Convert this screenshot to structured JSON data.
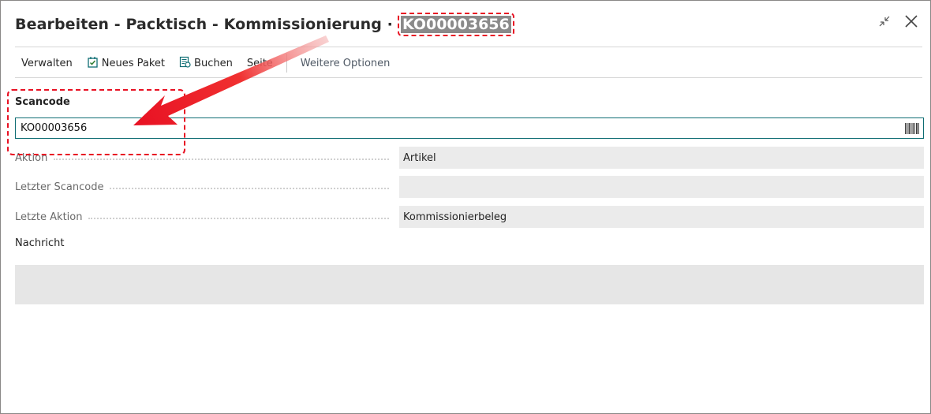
{
  "window": {
    "title": "Bearbeiten - Packtisch - Kommissionierung",
    "title_id": "KO00003656",
    "icons": {
      "collapse": "collapse-icon",
      "close": "close-icon"
    }
  },
  "toolbar": {
    "manage_label": "Verwalten",
    "new_package_label": "Neues Paket",
    "post_label": "Buchen",
    "page_label": "Seite",
    "more_options_label": "Weitere Optionen",
    "icons": {
      "new_package": "new-package-icon",
      "post": "post-icon"
    }
  },
  "form": {
    "scancode_label": "Scancode",
    "scancode_value": "KO00003656",
    "scancode_icon": "barcode-icon",
    "fields": [
      {
        "label": "Aktion",
        "value": "Artikel"
      },
      {
        "label": "Letzter Scancode",
        "value": ""
      },
      {
        "label": "Letzte Aktion",
        "value": "Kommissionierbeleg"
      }
    ],
    "message_label": "Nachricht",
    "message_value": ""
  },
  "annotation": {
    "color": "#e81123",
    "arrow_icon": "red-arrow-icon"
  },
  "colors": {
    "accent": "#0e6d73",
    "field_bg": "#ebebeb",
    "highlight": "#e81123"
  }
}
